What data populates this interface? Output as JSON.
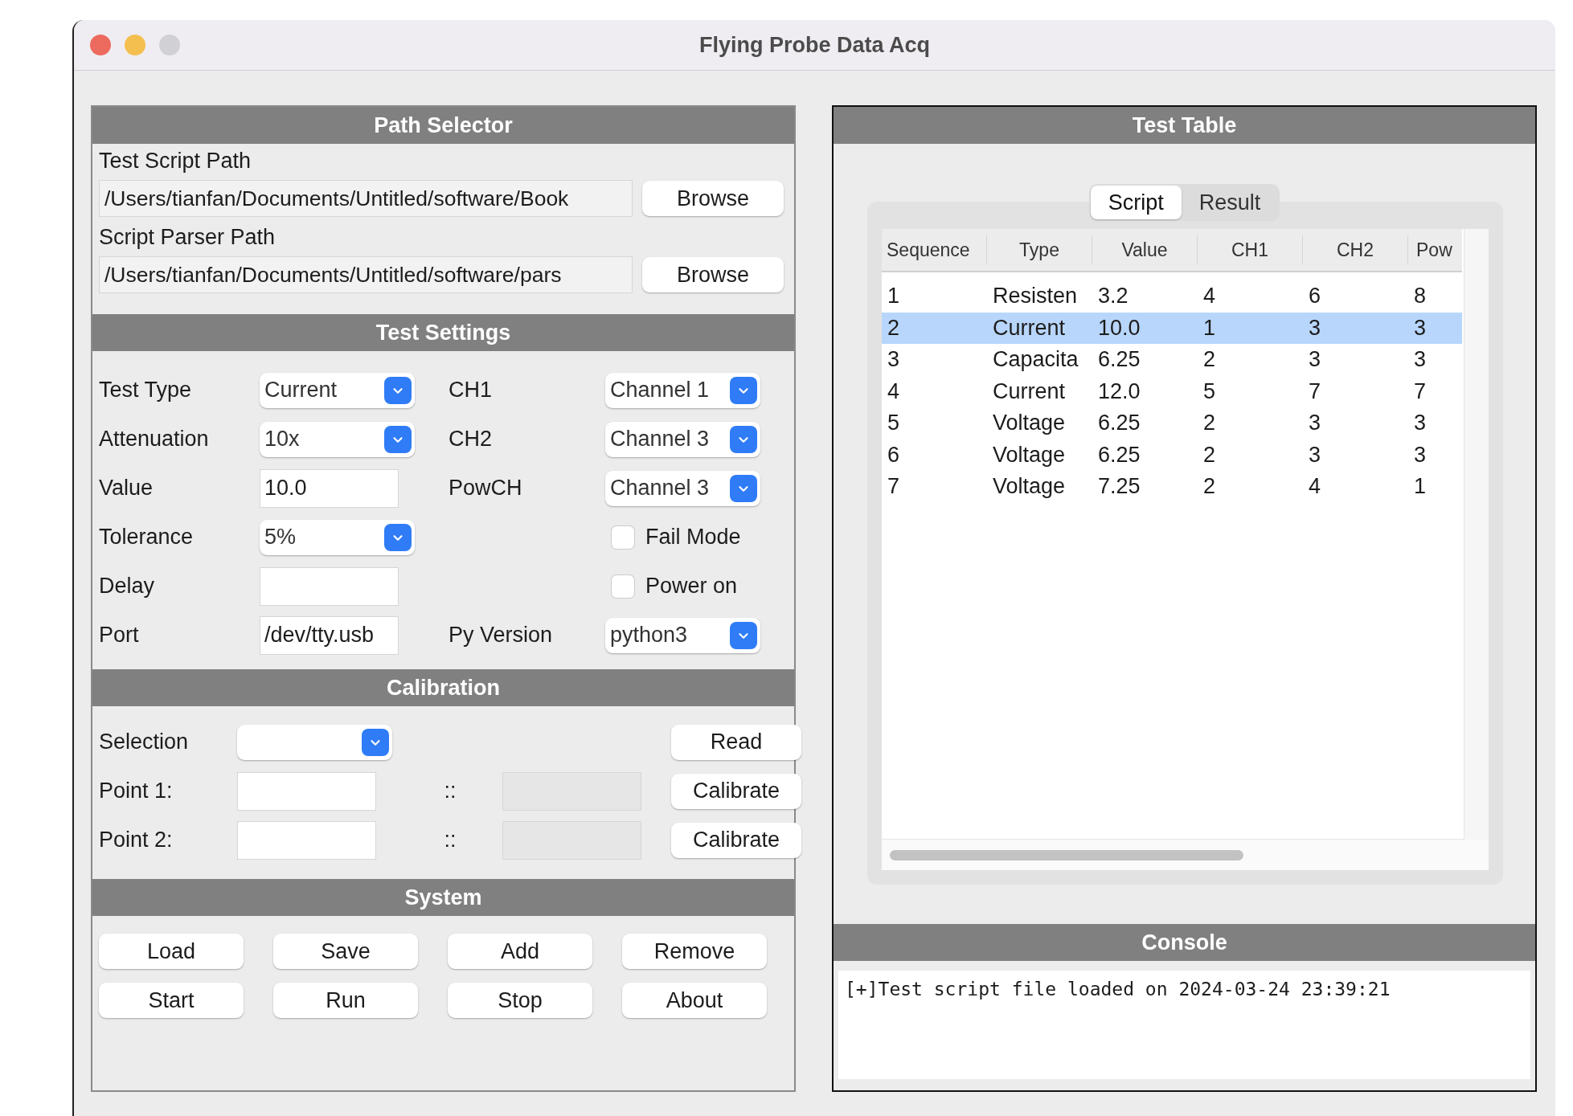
{
  "window": {
    "title": "Flying Probe Data Acq"
  },
  "path_selector": {
    "title": "Path Selector",
    "paths": [
      {
        "label": "Test Script Path",
        "value": "/Users/tianfan/Documents/Untitled/software/Book",
        "button": "Browse"
      },
      {
        "label": "Script Parser Path",
        "value": "/Users/tianfan/Documents/Untitled/software/pars",
        "button": "Browse"
      }
    ]
  },
  "test_settings": {
    "title": "Test Settings",
    "rows": [
      {
        "left": {
          "label": "Test Type",
          "kind": "dropdown",
          "value": "Current"
        },
        "right": {
          "label": "CH1",
          "kind": "dropdown",
          "value": "Channel 1"
        }
      },
      {
        "left": {
          "label": "Attenuation",
          "kind": "dropdown",
          "value": "10x"
        },
        "right": {
          "label": "CH2",
          "kind": "dropdown",
          "value": "Channel 3"
        }
      },
      {
        "left": {
          "label": "Value",
          "kind": "field",
          "value": "10.0"
        },
        "right": {
          "label": "PowCH",
          "kind": "dropdown",
          "value": "Channel 3"
        }
      },
      {
        "left": {
          "label": "Tolerance",
          "kind": "dropdown",
          "value": "5%"
        },
        "right": {
          "label": "Fail Mode",
          "kind": "checkbox",
          "checked": false
        }
      },
      {
        "left": {
          "label": "Delay",
          "kind": "field"
        },
        "right": {
          "label": "Power on",
          "kind": "checkbox",
          "checked": false
        }
      },
      {
        "left": {
          "label": "Port",
          "kind": "field",
          "value": "/dev/tty.usb"
        },
        "right": {
          "label": "Py Version",
          "kind": "dropdown",
          "value": "python3"
        }
      }
    ]
  },
  "calibration": {
    "title": "Calibration",
    "selection_label": "Selection",
    "read_button": "Read",
    "points": [
      {
        "label": "Point 1:",
        "separator": "::",
        "button": "Calibrate"
      },
      {
        "label": "Point 2:",
        "separator": "::",
        "button": "Calibrate"
      }
    ]
  },
  "system": {
    "title": "System",
    "buttons": [
      "Load",
      "Save",
      "Add",
      "Remove",
      "Start",
      "Run",
      "Stop",
      "About"
    ]
  },
  "test_table": {
    "title": "Test Table",
    "tabs": [
      {
        "label": "Script",
        "selected": true
      },
      {
        "label": "Result",
        "selected": false
      }
    ],
    "columns": [
      "Sequence",
      "Type",
      "Value",
      "CH1",
      "CH2",
      "Pow"
    ],
    "rows": [
      {
        "cells": [
          "1",
          "Resisten",
          "3.2",
          "4",
          "6",
          "8"
        ],
        "selected": false
      },
      {
        "cells": [
          "2",
          "Current",
          "10.0",
          "1",
          "3",
          "3"
        ],
        "selected": true
      },
      {
        "cells": [
          "3",
          "Capacita",
          "6.25",
          "2",
          "3",
          "3"
        ],
        "selected": false
      },
      {
        "cells": [
          "4",
          "Current",
          "12.0",
          "5",
          "7",
          "7"
        ],
        "selected": false
      },
      {
        "cells": [
          "5",
          "Voltage",
          "6.25",
          "2",
          "3",
          "3"
        ],
        "selected": false
      },
      {
        "cells": [
          "6",
          "Voltage",
          "6.25",
          "2",
          "3",
          "3"
        ],
        "selected": false
      },
      {
        "cells": [
          "7",
          "Voltage",
          "7.25",
          "2",
          "4",
          "1"
        ],
        "selected": false
      }
    ]
  },
  "console": {
    "title": "Console",
    "lines": [
      "[+]Test script file loaded on 2024-03-24 23:39:21"
    ]
  }
}
